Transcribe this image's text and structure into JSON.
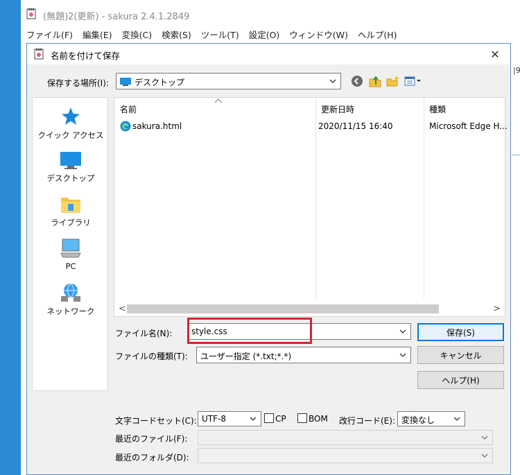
{
  "colors": {
    "desktop": "#2b8ad6",
    "dialog_bg": "#f0f0f0",
    "accent": "#0078d7",
    "highlight": "#d32631"
  },
  "background_window": {
    "title": "(無題)2(更新) - sakura 2.4.1.2849",
    "menu": [
      "ファイル(F)",
      "編集(E)",
      "変換(C)",
      "検索(S)",
      "ツール(T)",
      "設定(O)",
      "ウィンドウ(W)",
      "ヘルプ(H)"
    ],
    "edge_text": "|9"
  },
  "dialog": {
    "title": "名前を付けて保存",
    "close_glyph": "✕",
    "location_label": "保存する場所(I):",
    "location_value": "デスクトップ",
    "toolbar_icons": [
      "back-icon",
      "up-folder-icon",
      "new-folder-icon",
      "view-menu-icon"
    ],
    "places": [
      {
        "label": "クイック アクセス",
        "icon": "star-icon"
      },
      {
        "label": "デスクトップ",
        "icon": "desktop-icon"
      },
      {
        "label": "ライブラリ",
        "icon": "library-icon"
      },
      {
        "label": "PC",
        "icon": "pc-icon"
      },
      {
        "label": "ネットワーク",
        "icon": "network-icon"
      }
    ],
    "columns": [
      "名前",
      "更新日時",
      "種類"
    ],
    "files": [
      {
        "name": "sakura.html",
        "modified": "2020/11/15 16:40",
        "type": "Microsoft Edge H...",
        "icon": "edge-icon"
      }
    ],
    "scroll_left": "<",
    "scroll_right": ">",
    "filename_label": "ファイル名(N):",
    "filename_value": "style.css",
    "filetype_label": "ファイルの種類(T):",
    "filetype_value": "ユーザー指定 (*.txt;*.*)",
    "save_button": "保存(S)",
    "cancel_button": "キャンセル",
    "help_button": "ヘルプ(H)",
    "charset_label": "文字コードセット(C):",
    "charset_value": "UTF-8",
    "cp_label": "CP",
    "cp_checked": false,
    "bom_label": "BOM",
    "bom_checked": false,
    "newline_label": "改行コード(E):",
    "newline_value": "変換なし",
    "recent_files_label": "最近のファイル(F):",
    "recent_folders_label": "最近のフォルダ(D):"
  }
}
